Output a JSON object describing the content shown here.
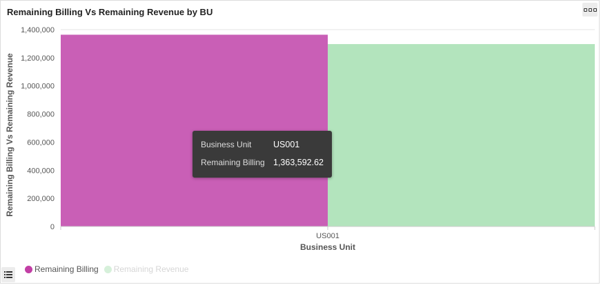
{
  "panel": {
    "title": "Remaining Billing Vs Remaining Revenue by BU",
    "menu_icon": "more-options-icon",
    "legend_toggle_icon": "list-icon"
  },
  "chart_data": {
    "type": "bar",
    "categories": [
      "US001"
    ],
    "series": [
      {
        "name": "Remaining Billing",
        "values": [
          1363592.62
        ],
        "color": "#c95fb6"
      },
      {
        "name": "Remaining Revenue",
        "values": [
          1297000
        ],
        "color": "#b3e4bd"
      }
    ],
    "xlabel": "Business Unit",
    "ylabel": "Remaining Billing Vs Remaining Revenue",
    "ylim": [
      0,
      1400000
    ],
    "yticks": [
      0,
      200000,
      400000,
      600000,
      800000,
      1000000,
      1200000,
      1400000
    ],
    "ytick_labels": [
      "0",
      "200,000",
      "400,000",
      "600,000",
      "800,000",
      "1,000,000",
      "1,200,000",
      "1,400,000"
    ],
    "grid": true,
    "legend": "bottom-left"
  },
  "tooltip": {
    "rows": [
      {
        "key": "Business Unit",
        "value": "US001"
      },
      {
        "key": "Remaining Billing",
        "value": "1,363,592.62"
      }
    ]
  },
  "legend": {
    "items": [
      {
        "label": "Remaining Billing",
        "color": "#c23fa5",
        "text_color": "#555555"
      },
      {
        "label": "Remaining Revenue",
        "color": "#d6f0da",
        "text_color": "#d6d6d6"
      }
    ]
  }
}
